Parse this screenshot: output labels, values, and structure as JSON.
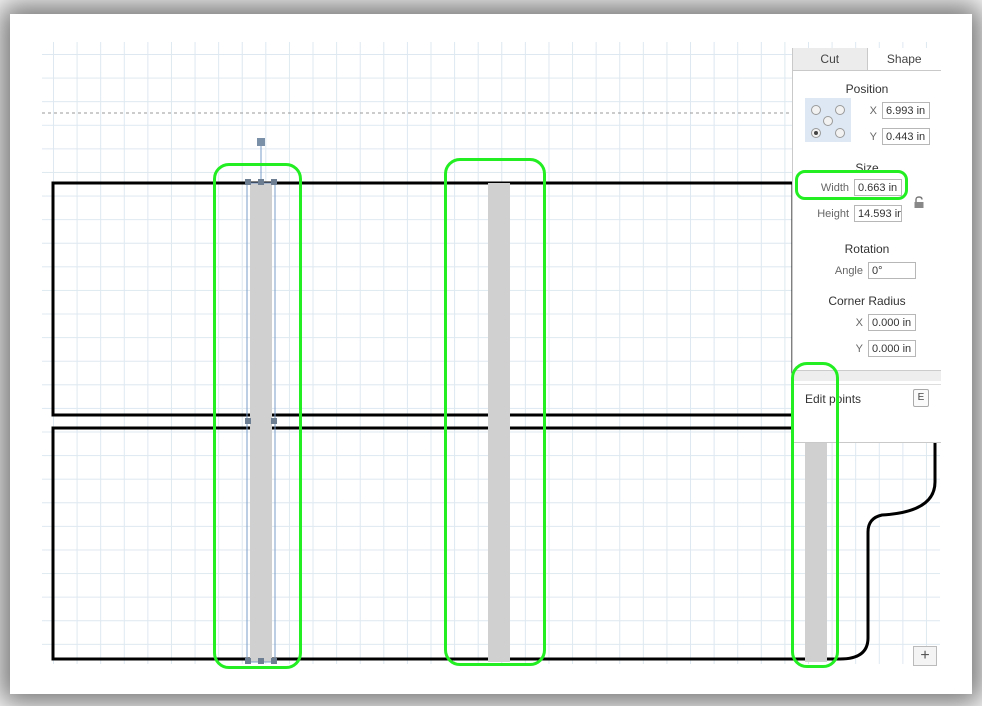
{
  "tabs": {
    "cut": "Cut",
    "shape": "Shape"
  },
  "position": {
    "title": "Position",
    "x_label": "X",
    "x_value": "6.993 in",
    "y_label": "Y",
    "y_value": "0.443 in"
  },
  "size": {
    "title": "Size",
    "width_label": "Width",
    "width_value": "0.663 in",
    "height_label": "Height",
    "height_value": "14.593 in"
  },
  "rotation": {
    "title": "Rotation",
    "angle_label": "Angle",
    "angle_value": "0°"
  },
  "corner_radius": {
    "title": "Corner Radius",
    "x_label": "X",
    "x_value": "0.000 in",
    "y_label": "Y",
    "y_value": "0.000 in"
  },
  "edit_points": {
    "label": "Edit points",
    "shortcut": "E"
  },
  "icons": {
    "lock": "lock-icon",
    "zoom": "zoom-in-icon"
  },
  "colors": {
    "highlight": "#22ee22",
    "shape_outline": "#000000",
    "slot_fill": "#d0d0d0",
    "selection": "#7a9cc8"
  }
}
